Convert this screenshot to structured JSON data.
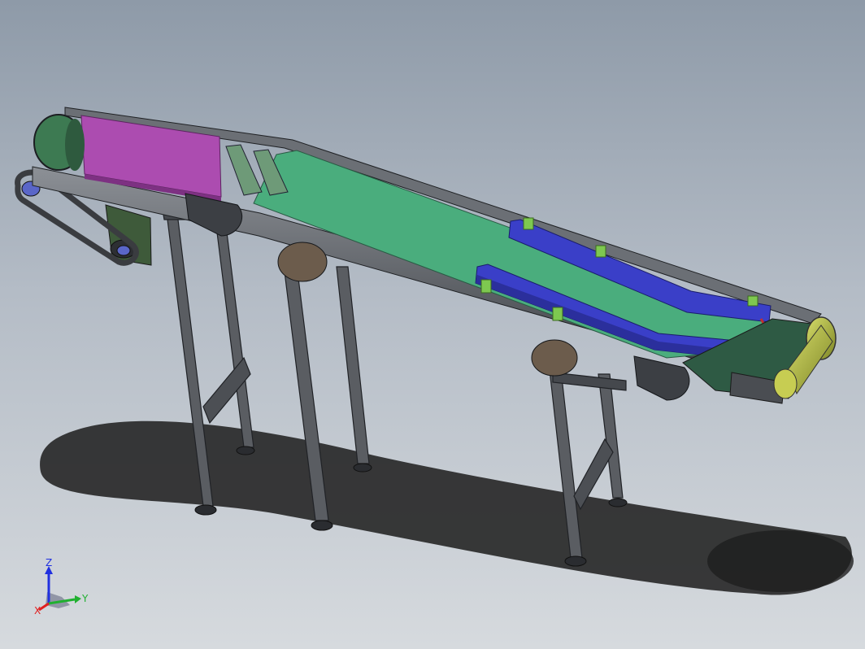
{
  "viewport": {
    "background_top": "#8e9aa8",
    "background_bottom": "#d6dade"
  },
  "model": {
    "parts": [
      {
        "name": "incline-belt",
        "color": "#4aad7d"
      },
      {
        "name": "infeed-belt",
        "color": "#ac4cb0"
      },
      {
        "name": "side-guide",
        "color": "#3a3fc8"
      },
      {
        "name": "tail-roller",
        "color": "#b9c34a"
      },
      {
        "name": "bracket",
        "color": "#7ec850"
      },
      {
        "name": "frame",
        "color": "#4a4d52"
      }
    ]
  },
  "triad": {
    "x_label": "X",
    "y_label": "Y",
    "z_label": "Z",
    "x_color": "#e02020",
    "y_color": "#20b030",
    "z_color": "#2030e0"
  }
}
